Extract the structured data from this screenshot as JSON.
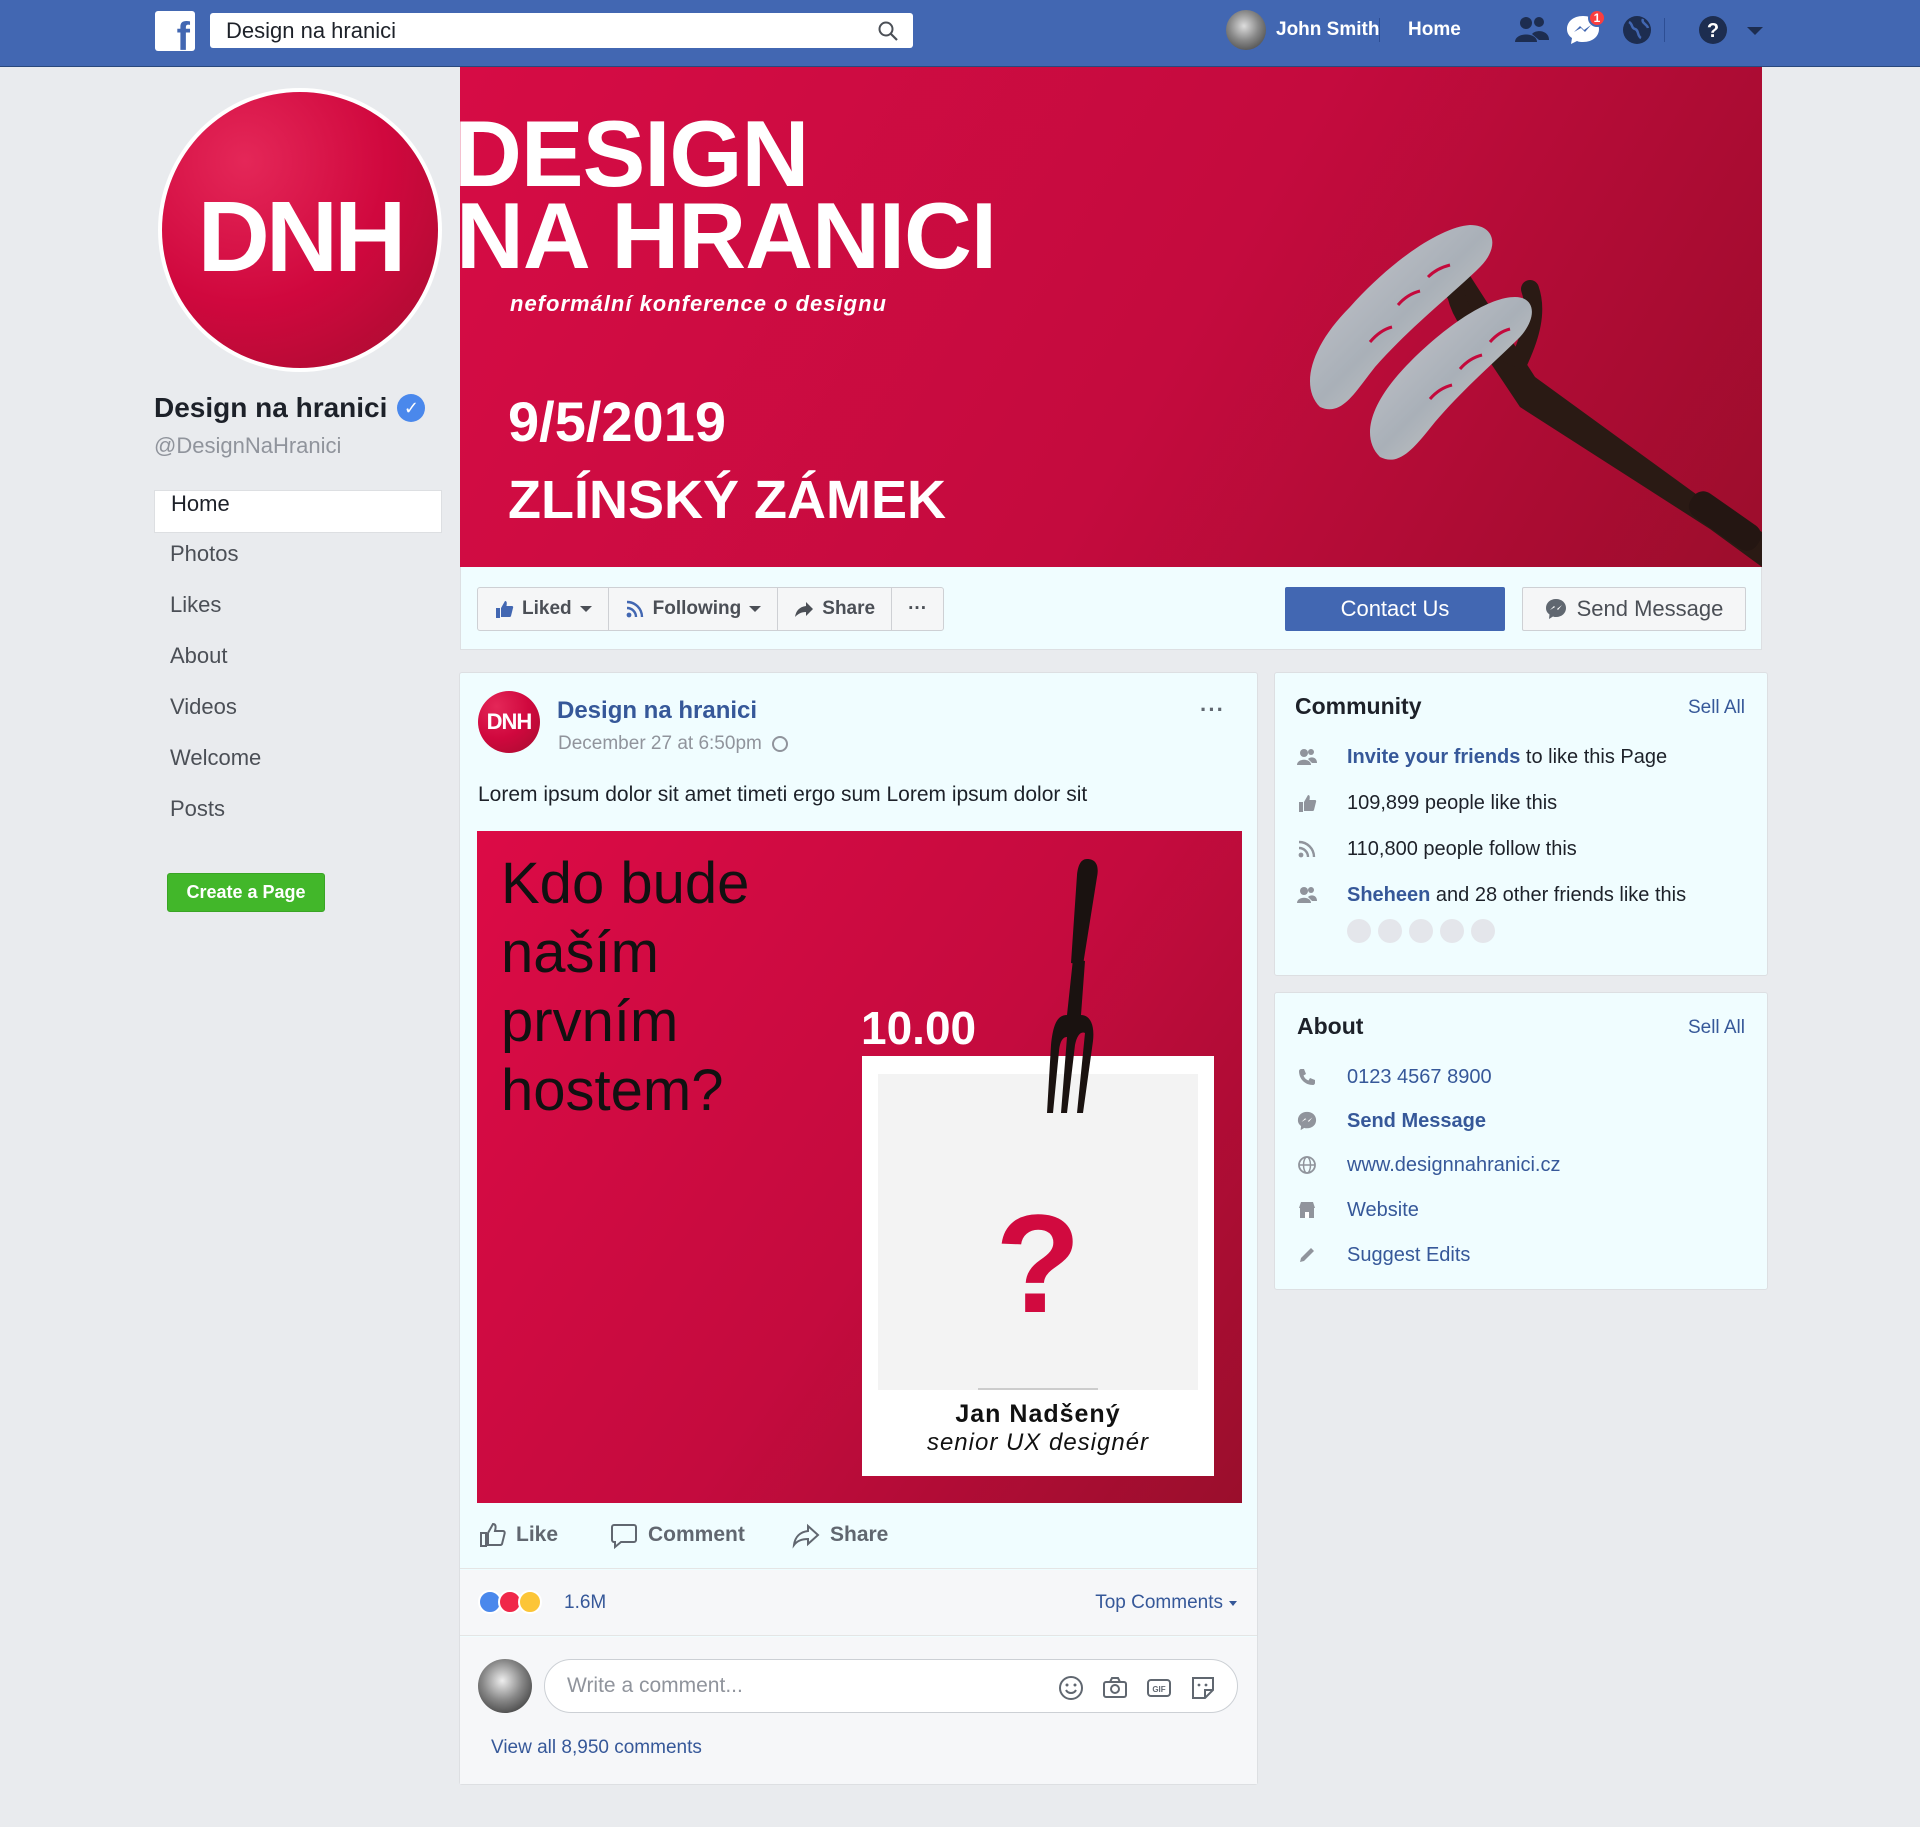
{
  "topbar": {
    "logo": "f",
    "search_value": "Design na hranici",
    "user_name": "John Smith",
    "home_label": "Home",
    "messages_badge": "1",
    "icons": [
      "friends-icon",
      "messenger-icon",
      "globe-icon",
      "help-icon",
      "caret-down-icon"
    ]
  },
  "profile": {
    "avatar_text": "DNH",
    "name": "Design na hranici",
    "verified_mark": "✓",
    "handle": "@DesignNaHranici"
  },
  "leftnav": {
    "items": [
      {
        "label": "Home",
        "active": true
      },
      {
        "label": "Photos"
      },
      {
        "label": "Likes"
      },
      {
        "label": "About"
      },
      {
        "label": "Videos"
      },
      {
        "label": "Welcome"
      },
      {
        "label": "Posts"
      }
    ],
    "create_page": "Create a Page"
  },
  "cover": {
    "title_line1": "DESIGN",
    "title_line2": "NA HRANICI",
    "subtitle": "neformální konference o designu",
    "date": "9/5/2019",
    "place": "ZLÍNSKÝ ZÁMEK"
  },
  "actions": {
    "liked": "Liked",
    "following": "Following",
    "share": "Share",
    "more": "···",
    "contact": "Contact Us",
    "send_message": "Send Message"
  },
  "post": {
    "avatar_text": "DNH",
    "author": "Design na hranici",
    "time": "December 27 at 6:50pm",
    "more": "···",
    "text": "Lorem ipsum dolor sit amet timeti ergo sum Lorem ipsum dolor sit",
    "image": {
      "headline": [
        "Kdo bude",
        "naším",
        "prvním",
        "hostem?"
      ],
      "time": "10.00",
      "question": "?",
      "guest_name": "Jan Nadšený",
      "guest_role": "senior UX designér"
    },
    "like": "Like",
    "comment": "Comment",
    "share": "Share",
    "reaction_count": "1.6M",
    "top_comments": "Top Comments",
    "comment_placeholder": "Write a comment...",
    "view_all": "View all 8,950 comments"
  },
  "community": {
    "title": "Community",
    "see_all": "Sell All",
    "invite_link": "Invite your friends",
    "invite_rest": " to like this Page",
    "likes": "109,899 people like this",
    "follows": "110,800 people follow this",
    "friend_link": "Sheheen",
    "friend_rest": " and 28 other friends like this"
  },
  "about": {
    "title": "About",
    "see_all": "Sell All",
    "phone": "0123 4567 8900",
    "send_message": "Send Message",
    "website_url": "www.designnahranici.cz",
    "website_label": "Website",
    "suggest": "Suggest Edits"
  },
  "colors": {
    "fb_blue": "#4267b2",
    "brand_red": "#d0083e",
    "green": "#42b72a",
    "link": "#365899"
  }
}
